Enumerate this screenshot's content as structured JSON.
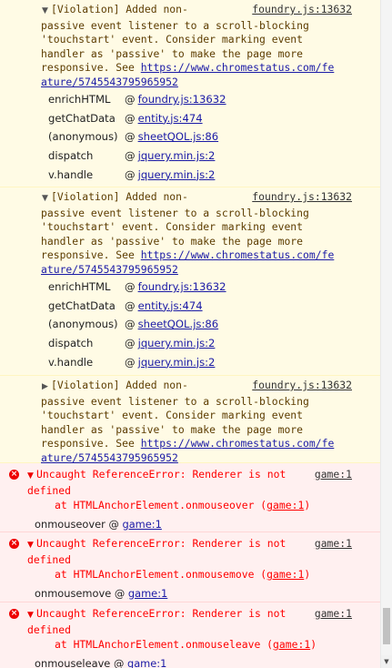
{
  "warnings": [
    {
      "expanded": true,
      "message_lines": [
        "[Violation] Added non-",
        "passive event listener to a scroll-blocking",
        "'touchstart' event. Consider marking event",
        "handler as 'passive' to make the page more",
        "responsive. See "
      ],
      "url_part1": "https://www.chromestatus.com/fe",
      "url_part2": "ature/5745543795965952",
      "source": "foundry.js:13632",
      "stack": [
        {
          "fn": "enrichHTML",
          "at": "@",
          "loc": "foundry.js:13632"
        },
        {
          "fn": "getChatData",
          "at": "@",
          "loc": "entity.js:474"
        },
        {
          "fn": "(anonymous)",
          "at": "@",
          "loc": "sheetQOL.js:86"
        },
        {
          "fn": "dispatch",
          "at": "@",
          "loc": "jquery.min.js:2"
        },
        {
          "fn": "v.handle",
          "at": "@",
          "loc": "jquery.min.js:2"
        }
      ]
    },
    {
      "expanded": true,
      "message_lines": [
        "[Violation] Added non-",
        "passive event listener to a scroll-blocking",
        "'touchstart' event. Consider marking event",
        "handler as 'passive' to make the page more",
        "responsive. See "
      ],
      "url_part1": "https://www.chromestatus.com/fe",
      "url_part2": "ature/5745543795965952",
      "source": "foundry.js:13632",
      "stack": [
        {
          "fn": "enrichHTML",
          "at": "@",
          "loc": "foundry.js:13632"
        },
        {
          "fn": "getChatData",
          "at": "@",
          "loc": "entity.js:474"
        },
        {
          "fn": "(anonymous)",
          "at": "@",
          "loc": "sheetQOL.js:86"
        },
        {
          "fn": "dispatch",
          "at": "@",
          "loc": "jquery.min.js:2"
        },
        {
          "fn": "v.handle",
          "at": "@",
          "loc": "jquery.min.js:2"
        }
      ]
    },
    {
      "expanded": false,
      "message_lines": [
        "[Violation] Added non-",
        "passive event listener to a scroll-blocking",
        "'touchstart' event. Consider marking event",
        "handler as 'passive' to make the page more",
        "responsive. See "
      ],
      "url_part1": "https://www.chromestatus.com/fe",
      "url_part2": "ature/5745543795965952",
      "source": "foundry.js:13632",
      "stack": []
    }
  ],
  "errors": [
    {
      "message_line1": "Uncaught ReferenceError: Renderer is not",
      "message_line2": "defined",
      "source": "game:1",
      "at_prefix": "at HTMLAnchorElement.onmouseover (",
      "at_link": "game:1",
      "at_suffix": ")",
      "handler": "onmouseover",
      "handler_at": "@",
      "handler_loc": "game:1"
    },
    {
      "message_line1": "Uncaught ReferenceError: Renderer is not",
      "message_line2": "defined",
      "source": "game:1",
      "at_prefix": "at HTMLAnchorElement.onmousemove (",
      "at_link": "game:1",
      "at_suffix": ")",
      "handler": "onmousemove",
      "handler_at": "@",
      "handler_loc": "game:1"
    },
    {
      "message_line1": "Uncaught ReferenceError: Renderer is not",
      "message_line2": "defined",
      "source": "game:1",
      "at_prefix": "at HTMLAnchorElement.onmouseleave (",
      "at_link": "game:1",
      "at_suffix": ")",
      "handler": "onmouseleave",
      "handler_at": "@",
      "handler_loc": "game:1"
    }
  ],
  "icons": {
    "expanded": "▼",
    "collapsed": "▶",
    "error": "×",
    "scroll_down": "▼"
  },
  "colors": {
    "warning_bg": "#fffbe5",
    "error_bg": "#fff0f0",
    "error_text": "#ff0000",
    "link": "#1a1aa6"
  }
}
